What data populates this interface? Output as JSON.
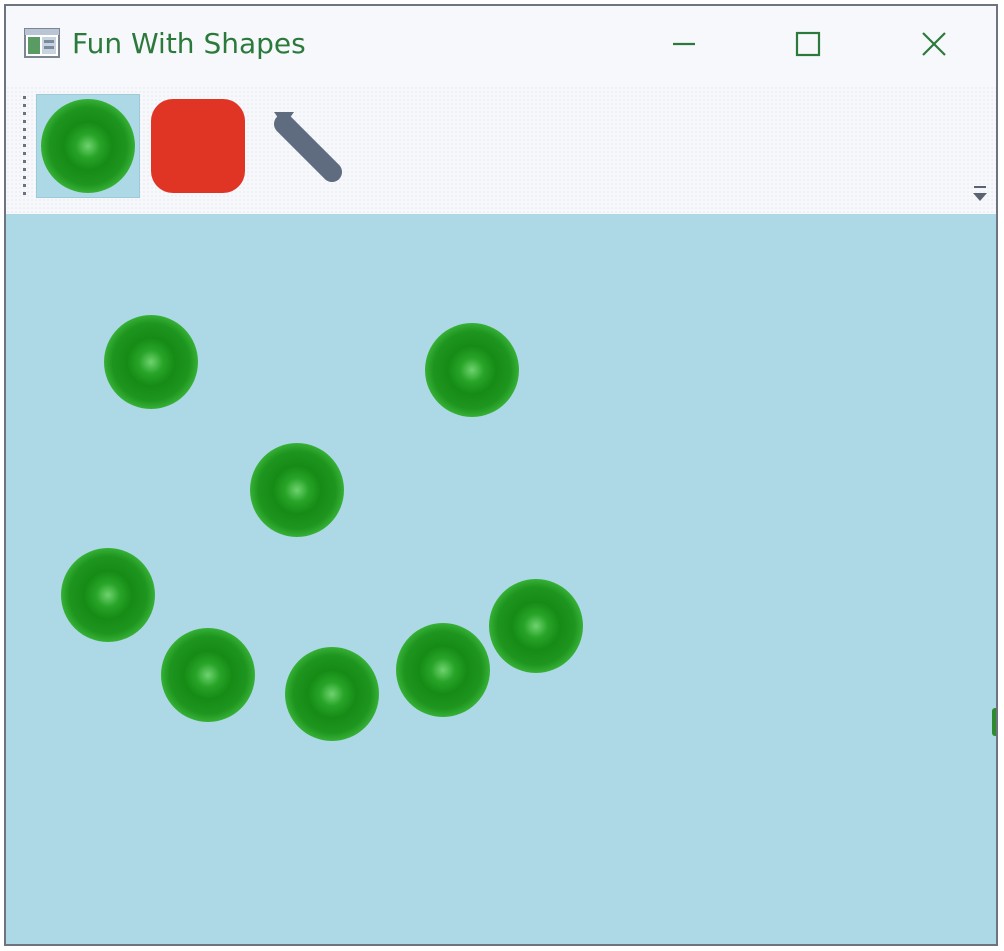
{
  "window": {
    "title": "Fun With Shapes",
    "icon": "app-window-icon",
    "controls": {
      "minimize": "minimize-icon",
      "maximize": "maximize-icon",
      "close": "close-icon"
    }
  },
  "toolbar": {
    "tools": [
      {
        "name": "circle",
        "icon": "green-circle-icon",
        "selected": true
      },
      {
        "name": "rectangle",
        "icon": "red-rounded-square-icon",
        "selected": false
      },
      {
        "name": "line",
        "icon": "gray-line-icon",
        "selected": false
      }
    ],
    "overflow_icon": "overflow-chevron-icon"
  },
  "canvas": {
    "background": "#add8e6",
    "shapes_count": 9,
    "shape_type": "circle"
  },
  "colors": {
    "title_text": "#2c7a3b",
    "control_glyph": "#2c7a3b",
    "titlebar_bg": "#f7f8fc",
    "canvas_bg": "#add8e6",
    "selected_tool_bg": "#add8e6",
    "circle_fill": "#1e951e",
    "rect_fill": "#e03424",
    "line_fill": "#5f6b7e"
  }
}
